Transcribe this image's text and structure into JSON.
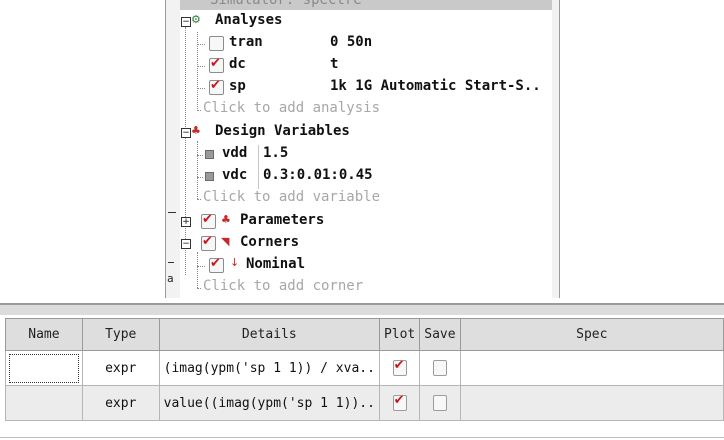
{
  "tree": {
    "header_text": "Simulator: spectre",
    "analyses": {
      "label": "Analyses",
      "items": [
        {
          "name": "tran",
          "checked": false,
          "args": "0 50n"
        },
        {
          "name": "dc",
          "checked": true,
          "args": "t"
        },
        {
          "name": "sp",
          "checked": true,
          "args": "1k 1G Automatic Start-S.."
        }
      ],
      "add_text": "Click to add analysis"
    },
    "design_variables": {
      "label": "Design Variables",
      "items": [
        {
          "name": "vdd",
          "value": "1.5"
        },
        {
          "name": "vdc",
          "value": "0.3:0.01:0.45"
        }
      ],
      "add_text": "Click to add variable"
    },
    "parameters": {
      "label": "Parameters",
      "checked": true
    },
    "corners": {
      "label": "Corners",
      "checked": true,
      "items": [
        {
          "name": "Nominal",
          "checked": true
        }
      ],
      "add_text": "Click to add corner"
    },
    "left_strip_text": "a"
  },
  "outputs": {
    "columns": [
      "Name",
      "Type",
      "Details",
      "Plot",
      "Save",
      "Spec"
    ],
    "rows": [
      {
        "name": "",
        "type": "expr",
        "details": "(imag(ypm('sp 1 1)) / xva..",
        "plot": true,
        "save": false,
        "spec": ""
      },
      {
        "name": "",
        "type": "expr",
        "details": "value((imag(ypm('sp 1 1))..",
        "plot": true,
        "save": false,
        "spec": ""
      }
    ]
  },
  "colors": {
    "check_mark": "#d0121a",
    "header_bg": "#dedede",
    "alt_row_bg": "#ececec"
  }
}
